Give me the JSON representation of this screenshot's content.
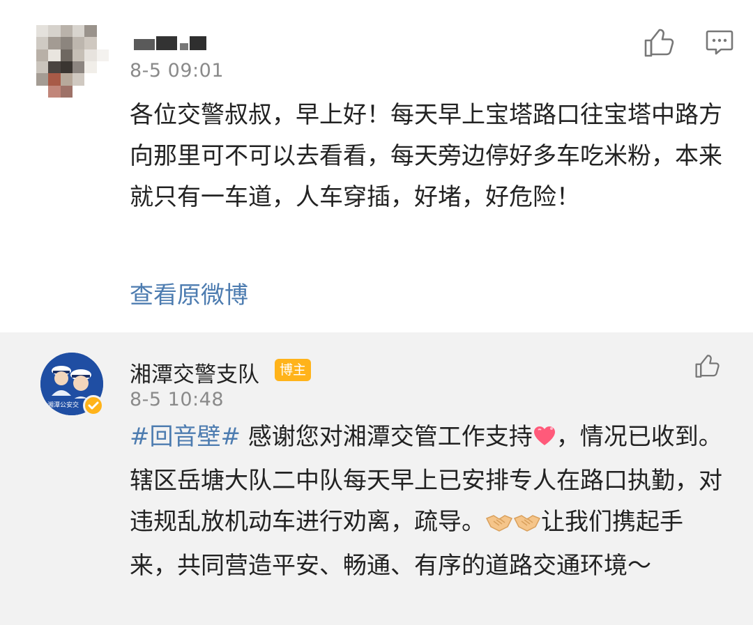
{
  "comment_user": {
    "time": "8-5 09:01",
    "text": "各位交警叔叔，早上好！每天早上宝塔路口往宝塔中路方向那里可不可以去看看，每天旁边停好多车吃米粉，本来就只有一车道，人车穿插，好堵，好危险！",
    "view_original": "查看原微博"
  },
  "comment_reply": {
    "name": "湘潭交警支队",
    "badge": "博主",
    "time": "8-5 10:48",
    "hashtag": "#回音壁#",
    "text_part1": " 感谢您对湘潭交管工作支持",
    "text_part2": "，情况已收到。辖区岳塘大队二中队每天早上已安排专人在路口执勤，对违规乱放机动车进行劝离，疏导。",
    "text_part3": "让我们携起手来，共同营造平安、畅通、有序的道路交通环境～",
    "avatar_text": "湘潭公安交"
  },
  "icons": {
    "like": "thumb-up-icon",
    "reply": "comment-bubble-icon",
    "verified": "verified-icon",
    "heart_emoji": "heart-emoji-icon",
    "handshake_emoji": "handshake-emoji-icon"
  },
  "colors": {
    "link": "#4d7cb0",
    "badge": "#ffb31a",
    "reply_background": "#f2f2f2",
    "avatar_blue": "#1f4ea3"
  }
}
